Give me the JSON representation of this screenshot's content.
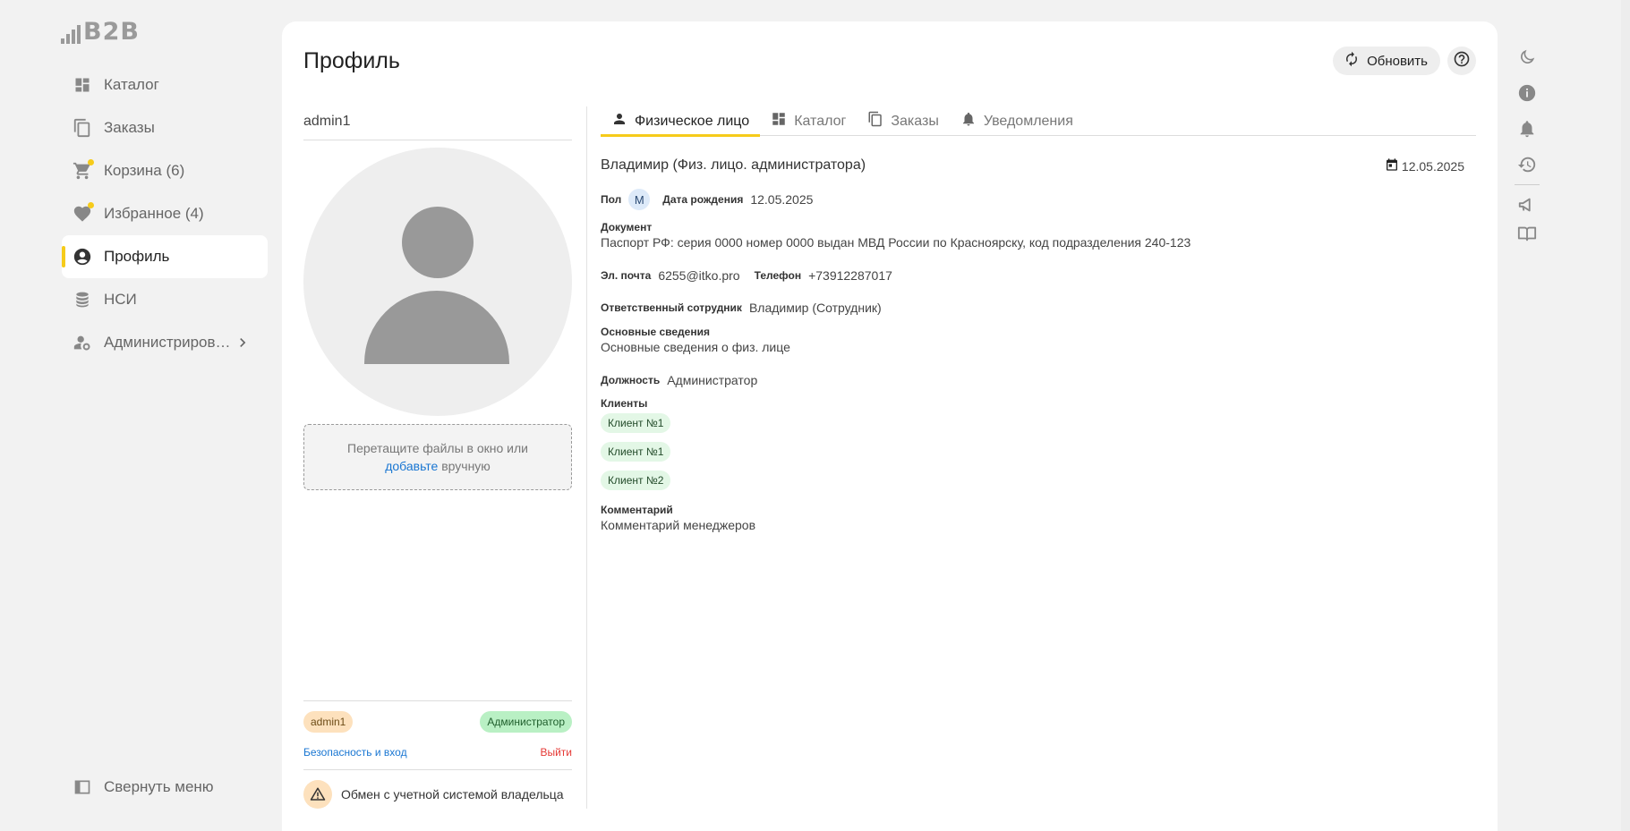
{
  "app": {
    "logo_text": "B2B"
  },
  "sidebar": {
    "items": [
      {
        "label": "Каталог",
        "icon": "dashboard-icon"
      },
      {
        "label": "Заказы",
        "icon": "copy-icon"
      },
      {
        "label": "Корзина (6)",
        "icon": "cart-icon",
        "dot": true
      },
      {
        "label": "Избранное (4)",
        "icon": "heart-icon",
        "dot": true
      },
      {
        "label": "Профиль",
        "icon": "account-circle-icon",
        "active": true
      },
      {
        "label": "НСИ",
        "icon": "database-icon"
      },
      {
        "label": "Администриров…",
        "icon": "manage-accounts-icon",
        "has_children": true
      }
    ],
    "collapse_label": "Свернуть меню"
  },
  "header": {
    "title": "Профиль",
    "refresh_label": "Обновить"
  },
  "profile": {
    "username": "admin1",
    "dropzone_text": "Перетащите файлы в окно или",
    "dropzone_link": "добавьте",
    "dropzone_suffix": " вручную",
    "badge_user": "admin1",
    "badge_role": "Администратор",
    "security_link": "Безопасность и вход",
    "logout_link": "Выйти",
    "sync_text": "Обмен с учетной системой владельца"
  },
  "tabs": [
    {
      "label": "Физическое лицо",
      "icon": "person-icon",
      "active": true
    },
    {
      "label": "Каталог",
      "icon": "dashboard-icon"
    },
    {
      "label": "Заказы",
      "icon": "copy-icon"
    },
    {
      "label": "Уведомления",
      "icon": "bell-icon"
    }
  ],
  "details": {
    "full_name": "Владимир (Физ. лицо. администратора)",
    "date": "12.05.2025",
    "gender_label": "Пол",
    "gender_value": "М",
    "birth_label": "Дата рождения",
    "birth_value": "12.05.2025",
    "document_label": "Документ",
    "document_value": "Паспорт РФ: серия 0000 номер 0000 выдан МВД России по Красноярску, код подразделения 240-123",
    "email_label": "Эл. почта",
    "email_value": "6255@itko.pro",
    "phone_label": "Телефон",
    "phone_value": "+73912287017",
    "responsible_label": "Ответственный сотрудник",
    "responsible_value": "Владимир (Сотрудник)",
    "basic_label": "Основные сведения",
    "basic_value": "Основные сведения о физ. лице",
    "position_label": "Должность",
    "position_value": "Администратор",
    "clients_label": "Клиенты",
    "clients": [
      "Клиент №1",
      "Клиент №1",
      "Клиент №2"
    ],
    "comment_label": "Комментарий",
    "comment_value": "Комментарий менеджеров"
  },
  "rail": [
    "moon-icon",
    "info-icon",
    "bell-icon",
    "history-icon",
    "megaphone-icon",
    "book-icon"
  ],
  "colors": {
    "accent": "#f6cb1a",
    "link": "#1976d2",
    "danger": "#e53935"
  }
}
